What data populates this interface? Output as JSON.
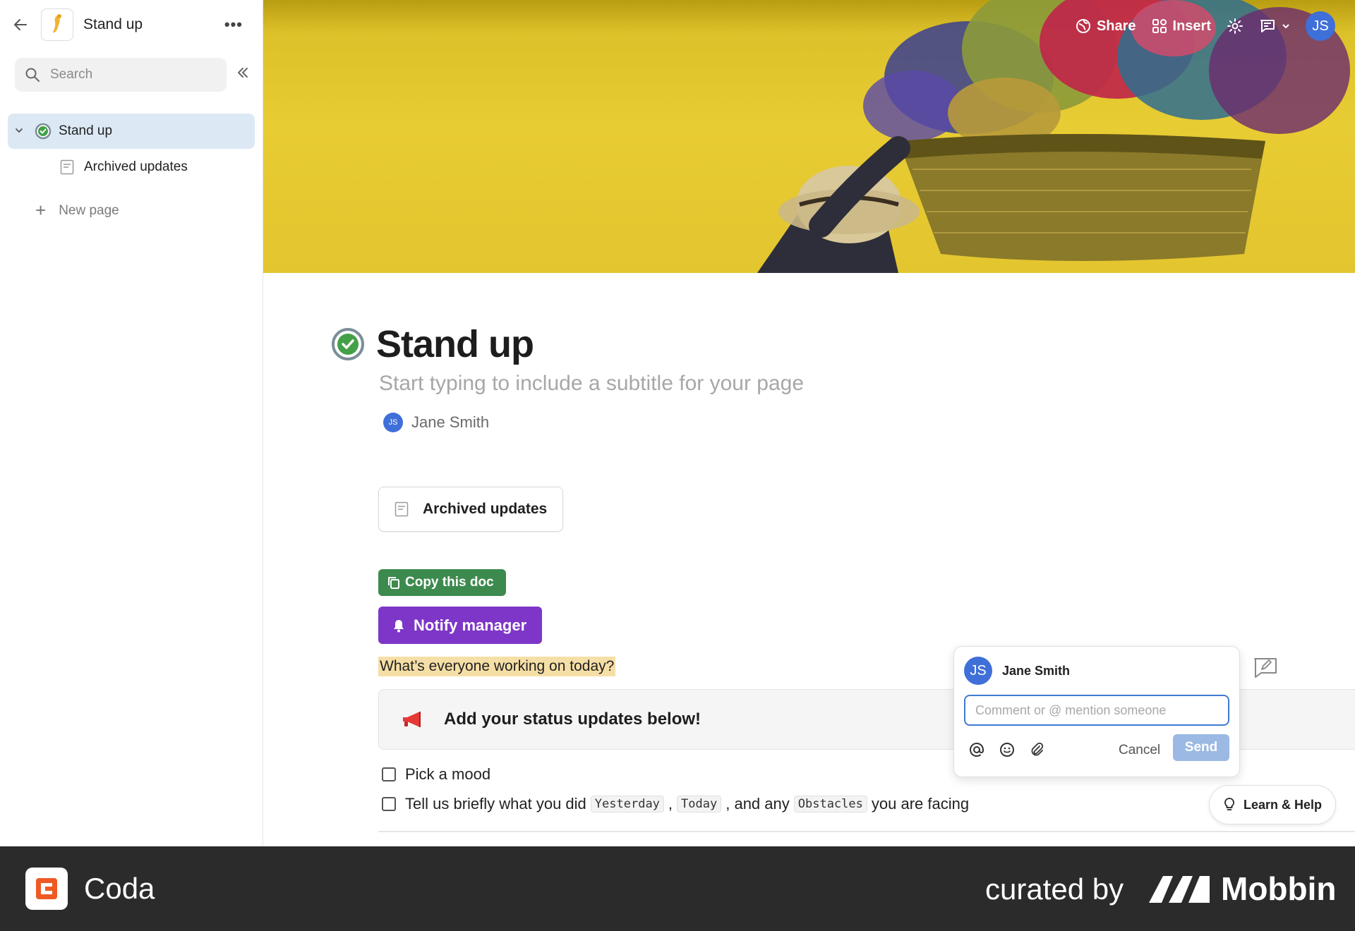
{
  "sidebar": {
    "doc_name": "Stand up",
    "search_placeholder": "Search",
    "tree": [
      {
        "label": "Stand up"
      },
      {
        "label": "Archived updates"
      }
    ],
    "new_page": "New page"
  },
  "topbar": {
    "share": "Share",
    "insert": "Insert",
    "avatar_initials": "JS"
  },
  "page": {
    "title": "Stand up",
    "subtitle": "Start typing to include a subtitle for your page",
    "author_initials": "JS",
    "author": "Jane Smith",
    "card_label": "Archived updates",
    "copy_button": "Copy this doc",
    "notify_button": "Notify manager",
    "question": "What’s everyone working on today?",
    "callout": "Add your status updates below!",
    "check1": "Pick a mood",
    "check2_a": "Tell us briefly what you did",
    "code_yesterday": "Yesterday",
    "sep1": ",",
    "code_today": "Today",
    "check2_b": ", and any",
    "code_obstacles": "Obstacles",
    "check2_c": "you are facing"
  },
  "comment": {
    "avatar_initials": "JS",
    "name": "Jane Smith",
    "placeholder": "Comment or @ mention someone",
    "cancel": "Cancel",
    "send": "Send"
  },
  "help": {
    "label": "Learn & Help"
  },
  "footer": {
    "app": "Coda",
    "curated": "curated by",
    "brand": "Mobbin"
  },
  "colors": {
    "accent_blue": "#3f6fd8",
    "copy_green": "#3d8a4e",
    "notify_purple": "#7d36c7",
    "cover_yellow": "#e3c52f",
    "highlight": "#f6dfa6"
  }
}
